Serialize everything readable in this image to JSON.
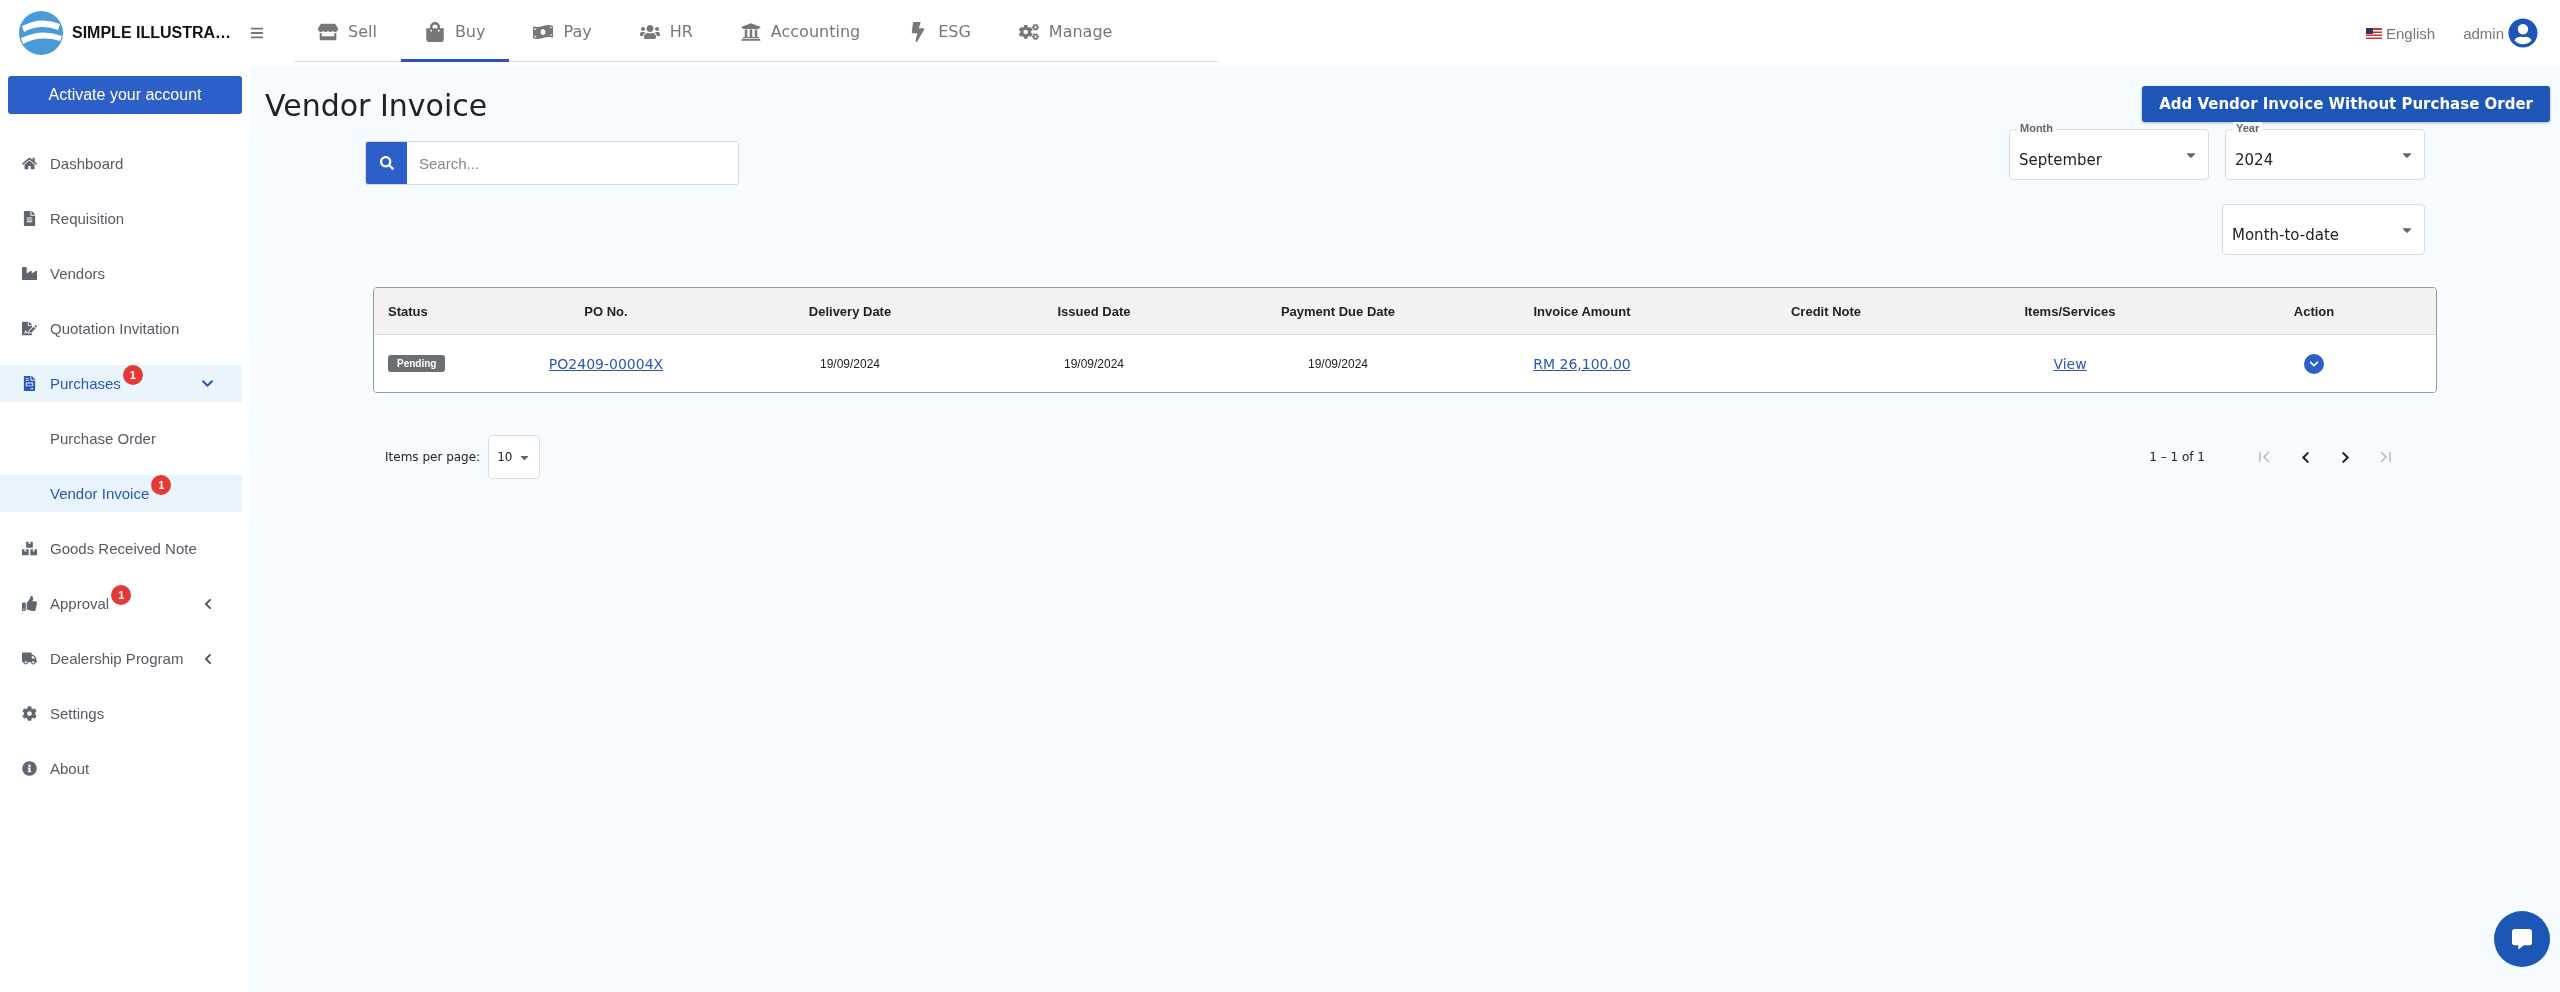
{
  "brand": {
    "name": "SIMPLE ILLUSTRA…"
  },
  "activate_button": "Activate your account",
  "sidebar": {
    "items": [
      {
        "label": "Dashboard",
        "selected": false
      },
      {
        "label": "Requisition",
        "selected": false
      },
      {
        "label": "Vendors",
        "selected": false
      },
      {
        "label": "Quotation Invitation",
        "selected": false
      },
      {
        "label": "Purchases",
        "selected": true,
        "badge": "1",
        "expanded": true,
        "children": [
          {
            "label": "Purchase Order",
            "selected": false
          },
          {
            "label": "Vendor Invoice",
            "selected": true,
            "badge": "1"
          }
        ]
      },
      {
        "label": "Goods Received Note",
        "selected": false
      },
      {
        "label": "Approval",
        "selected": false,
        "badge": "1",
        "expanded": false
      },
      {
        "label": "Dealership Program",
        "selected": false,
        "expanded": false
      },
      {
        "label": "Settings",
        "selected": false
      },
      {
        "label": "About",
        "selected": false
      }
    ]
  },
  "top_tabs": [
    {
      "label": "Sell",
      "selected": false
    },
    {
      "label": "Buy",
      "selected": true
    },
    {
      "label": "Pay",
      "selected": false
    },
    {
      "label": "HR",
      "selected": false
    },
    {
      "label": "Accounting",
      "selected": false
    },
    {
      "label": "ESG",
      "selected": false
    },
    {
      "label": "Manage",
      "selected": false
    }
  ],
  "language": "English",
  "user": "admin",
  "page_title": "Vendor Invoice",
  "add_button": "Add Vendor Invoice Without Purchase Order",
  "search": {
    "placeholder": "Search..."
  },
  "filters": [
    {
      "label": "Month",
      "value": "September"
    },
    {
      "label": "Year",
      "value": "2024"
    }
  ],
  "range": {
    "value": "Month-to-date"
  },
  "table": {
    "columns": [
      "Status",
      "PO No.",
      "Delivery Date",
      "Issued Date",
      "Payment Due Date",
      "Invoice Amount",
      "Credit Note",
      "Items/Services",
      "Action"
    ],
    "rows": [
      {
        "status": "Pending",
        "po_no": "PO2409-00004X",
        "delivery_date": "19/09/2024",
        "issued_date": "19/09/2024",
        "payment_due_date": "19/09/2024",
        "invoice_amount": "RM 26,100.00",
        "items": "View"
      }
    ]
  },
  "pagination": {
    "items_per_page_label": "Items per page:",
    "items_per_page": "10",
    "range": "1 – 1 of 1",
    "buttons": [
      {
        "kind": "first",
        "disabled": true
      },
      {
        "kind": "prev",
        "disabled": false
      },
      {
        "kind": "next",
        "disabled": false
      },
      {
        "kind": "last",
        "disabled": true
      }
    ]
  }
}
